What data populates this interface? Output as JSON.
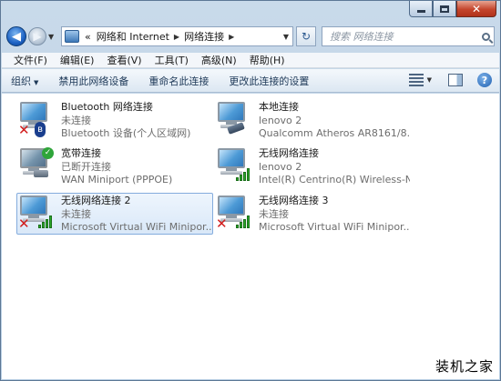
{
  "window": {
    "controls": {
      "minimize": "minimize-icon",
      "maximize": "maximize-icon",
      "close": "close-icon"
    }
  },
  "nav": {
    "crumb_prefix": "«",
    "breadcrumbs": [
      "网络和 Internet",
      "网络连接"
    ],
    "search_placeholder": "搜索 网络连接"
  },
  "menu": [
    "文件(F)",
    "编辑(E)",
    "查看(V)",
    "工具(T)",
    "高级(N)",
    "帮助(H)"
  ],
  "commands": {
    "organize": "组织",
    "disable": "禁用此网络设备",
    "rename": "重命名此连接",
    "change": "更改此连接的设置"
  },
  "connections": [
    {
      "name": "Bluetooth 网络连接",
      "status": "未连接",
      "device": "Bluetooth 设备(个人区域网)",
      "icon": "bluetooth",
      "selected": false
    },
    {
      "name": "本地连接",
      "status": "lenovo  2",
      "device": "Qualcomm Atheros AR8161/8...",
      "icon": "ethernet",
      "selected": false
    },
    {
      "name": "宽带连接",
      "status": "已断开连接",
      "device": "WAN Miniport (PPPOE)",
      "icon": "broadband",
      "selected": false
    },
    {
      "name": "无线网络连接",
      "status": "lenovo  2",
      "device": "Intel(R) Centrino(R) Wireless-N...",
      "icon": "wifi",
      "selected": false
    },
    {
      "name": "无线网络连接 2",
      "status": "未连接",
      "device": "Microsoft Virtual WiFi Minipor...",
      "icon": "wifi-disconnected",
      "selected": true
    },
    {
      "name": "无线网络连接 3",
      "status": "未连接",
      "device": "Microsoft Virtual WiFi Minipor...",
      "icon": "wifi-disconnected",
      "selected": false
    }
  ],
  "watermark": "装机之家"
}
